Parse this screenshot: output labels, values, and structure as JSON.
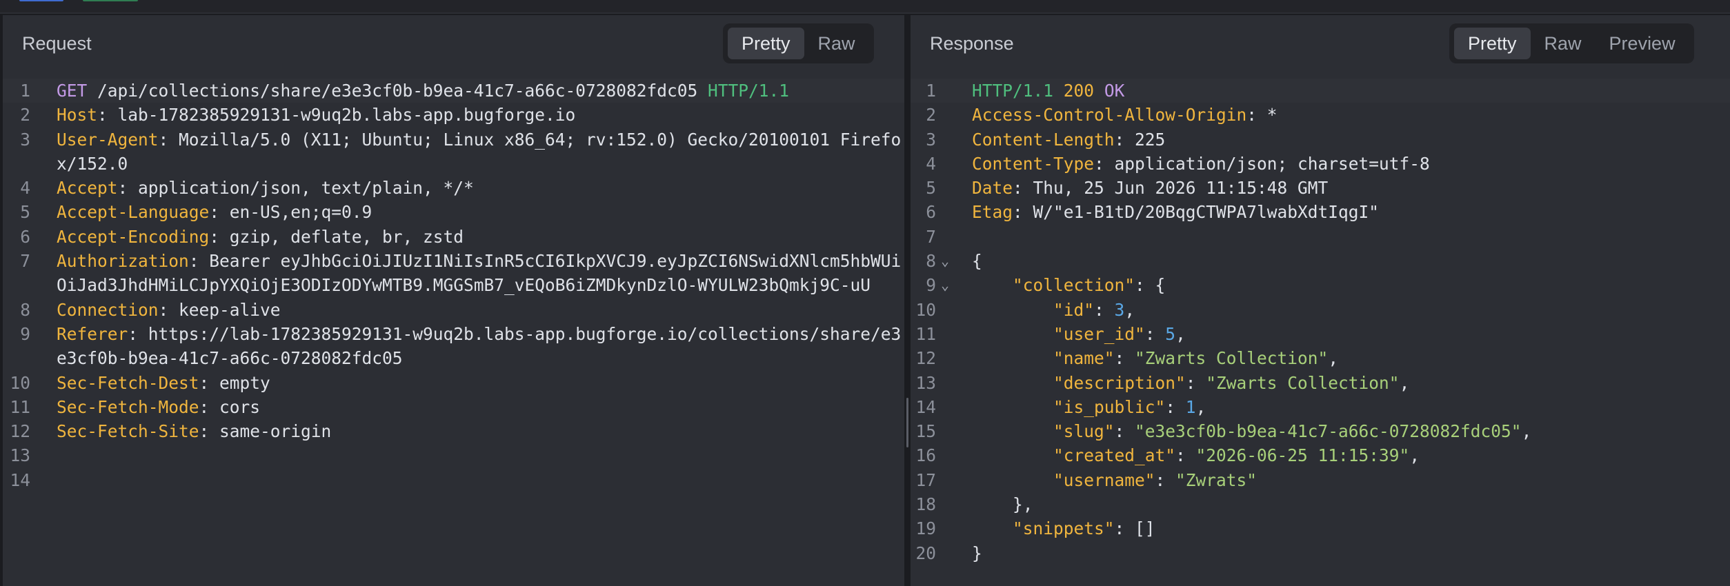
{
  "request": {
    "title": "Request",
    "view_tabs": [
      "Pretty",
      "Raw"
    ],
    "active_tab": "Pretty",
    "request_line": {
      "method": "GET",
      "path": " /api/collections/share/e3e3cf0b-b9ea-41c7-a66c-0728082fdc05 ",
      "protocol": "HTTP/1.1"
    },
    "headers": [
      {
        "name": "Host",
        "value": "lab-1782385929131-w9uq2b.labs-app.bugforge.io"
      },
      {
        "name": "User-Agent",
        "value": "Mozilla/5.0 (X11; Ubuntu; Linux x86_64; rv:152.0) Gecko/20100101 Firefox/152.0"
      },
      {
        "name": "Accept",
        "value": "application/json, text/plain, */*"
      },
      {
        "name": "Accept-Language",
        "value": "en-US,en;q=0.9"
      },
      {
        "name": "Accept-Encoding",
        "value": "gzip, deflate, br, zstd"
      },
      {
        "name": "Authorization",
        "value": "Bearer eyJhbGciOiJIUzI1NiIsInR5cCI6IkpXVCJ9.eyJpZCI6NSwidXNlcm5hbWUiOiJad3JhdHMiLCJpYXQiOjE3ODIzODYwMTB9.MGGSmB7_vEQoB6iZMDkynDzlO-WYULW23bQmkj9C-uU"
      },
      {
        "name": "Connection",
        "value": "keep-alive"
      },
      {
        "name": "Referer",
        "value": "https://lab-1782385929131-w9uq2b.labs-app.bugforge.io/collections/share/e3e3cf0b-b9ea-41c7-a66c-0728082fdc05"
      },
      {
        "name": "Sec-Fetch-Dest",
        "value": "empty"
      },
      {
        "name": "Sec-Fetch-Mode",
        "value": "cors"
      },
      {
        "name": "Sec-Fetch-Site",
        "value": "same-origin"
      }
    ],
    "line_numbers": [
      "1",
      "2",
      "3",
      "4",
      "5",
      "6",
      "7",
      "8",
      "9",
      "10",
      "11",
      "12",
      "13",
      "14"
    ]
  },
  "response": {
    "title": "Response",
    "view_tabs": [
      "Pretty",
      "Raw",
      "Preview"
    ],
    "active_tab": "Pretty",
    "status_line": {
      "protocol": "HTTP/1.1",
      "code": "200",
      "text": "OK"
    },
    "headers": [
      {
        "name": "Access-Control-Allow-Origin",
        "value": "*"
      },
      {
        "name": "Content-Length",
        "value": "225"
      },
      {
        "name": "Content-Type",
        "value": "application/json; charset=utf-8"
      },
      {
        "name": "Date",
        "value": "Thu, 25 Jun 2026 11:15:48 GMT"
      },
      {
        "name": "Etag",
        "value": "W/\"e1-B1tD/20BqgCTWPA7lwabXdtIqgI\""
      }
    ],
    "body_lines": [
      {
        "n": "8",
        "fold": true,
        "parts": [
          {
            "t": "{",
            "c": "punc"
          }
        ]
      },
      {
        "n": "9",
        "fold": true,
        "parts": [
          {
            "t": "    ",
            "c": "punc"
          },
          {
            "t": "\"collection\"",
            "c": "jkey"
          },
          {
            "t": ": {",
            "c": "punc"
          }
        ]
      },
      {
        "n": "10",
        "parts": [
          {
            "t": "        ",
            "c": "punc"
          },
          {
            "t": "\"id\"",
            "c": "jkey"
          },
          {
            "t": ": ",
            "c": "punc"
          },
          {
            "t": "3",
            "c": "jnum"
          },
          {
            "t": ",",
            "c": "punc"
          }
        ]
      },
      {
        "n": "11",
        "parts": [
          {
            "t": "        ",
            "c": "punc"
          },
          {
            "t": "\"user_id\"",
            "c": "jkey"
          },
          {
            "t": ": ",
            "c": "punc"
          },
          {
            "t": "5",
            "c": "jnum"
          },
          {
            "t": ",",
            "c": "punc"
          }
        ]
      },
      {
        "n": "12",
        "parts": [
          {
            "t": "        ",
            "c": "punc"
          },
          {
            "t": "\"name\"",
            "c": "jkey"
          },
          {
            "t": ": ",
            "c": "punc"
          },
          {
            "t": "\"Zwarts Collection\"",
            "c": "jstr"
          },
          {
            "t": ",",
            "c": "punc"
          }
        ]
      },
      {
        "n": "13",
        "parts": [
          {
            "t": "        ",
            "c": "punc"
          },
          {
            "t": "\"description\"",
            "c": "jkey"
          },
          {
            "t": ": ",
            "c": "punc"
          },
          {
            "t": "\"Zwarts Collection\"",
            "c": "jstr"
          },
          {
            "t": ",",
            "c": "punc"
          }
        ]
      },
      {
        "n": "14",
        "parts": [
          {
            "t": "        ",
            "c": "punc"
          },
          {
            "t": "\"is_public\"",
            "c": "jkey"
          },
          {
            "t": ": ",
            "c": "punc"
          },
          {
            "t": "1",
            "c": "jnum"
          },
          {
            "t": ",",
            "c": "punc"
          }
        ]
      },
      {
        "n": "15",
        "parts": [
          {
            "t": "        ",
            "c": "punc"
          },
          {
            "t": "\"slug\"",
            "c": "jkey"
          },
          {
            "t": ": ",
            "c": "punc"
          },
          {
            "t": "\"e3e3cf0b-b9ea-41c7-a66c-0728082fdc05\"",
            "c": "jstr"
          },
          {
            "t": ",",
            "c": "punc"
          }
        ]
      },
      {
        "n": "16",
        "parts": [
          {
            "t": "        ",
            "c": "punc"
          },
          {
            "t": "\"created_at\"",
            "c": "jkey"
          },
          {
            "t": ": ",
            "c": "punc"
          },
          {
            "t": "\"2026-06-25 11:15:39\"",
            "c": "jstr"
          },
          {
            "t": ",",
            "c": "punc"
          }
        ]
      },
      {
        "n": "17",
        "parts": [
          {
            "t": "        ",
            "c": "punc"
          },
          {
            "t": "\"username\"",
            "c": "jkey"
          },
          {
            "t": ": ",
            "c": "punc"
          },
          {
            "t": "\"Zwrats\"",
            "c": "jstr"
          }
        ]
      },
      {
        "n": "18",
        "parts": [
          {
            "t": "    },",
            "c": "punc"
          }
        ]
      },
      {
        "n": "19",
        "parts": [
          {
            "t": "    ",
            "c": "punc"
          },
          {
            "t": "\"snippets\"",
            "c": "jkey"
          },
          {
            "t": ": []",
            "c": "punc"
          }
        ]
      },
      {
        "n": "20",
        "parts": [
          {
            "t": "}",
            "c": "punc"
          }
        ]
      }
    ],
    "line_numbers": [
      "1",
      "2",
      "3",
      "4",
      "5",
      "6",
      "7"
    ]
  },
  "colors": {
    "background": "#2c2e34",
    "method": "#c39ae6",
    "protocol": "#4fbf7e",
    "header_name": "#f0b53e",
    "json_string": "#a8d07a",
    "json_number": "#5aa8e6"
  },
  "icons": {
    "fold": "chevron-down-icon"
  }
}
